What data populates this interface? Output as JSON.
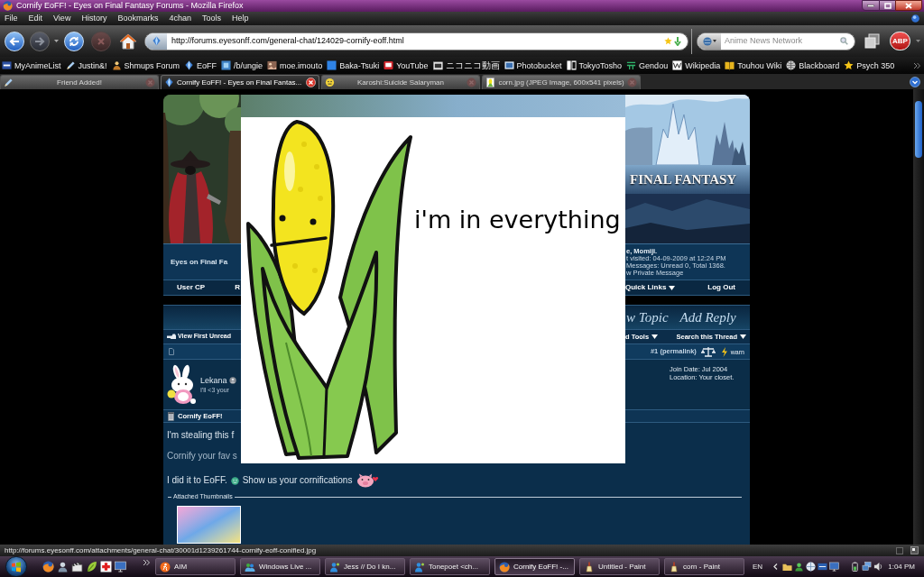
{
  "window": {
    "title": "Cornify EoFF! - Eyes on Final Fantasy Forums - Mozilla Firefox"
  },
  "menu": [
    "File",
    "Edit",
    "View",
    "History",
    "Bookmarks",
    "4chan",
    "Tools",
    "Help"
  ],
  "navigation": {
    "url": "http://forums.eyesonff.com/general-chat/124029-cornify-eoff.html",
    "search": {
      "placeholder": "Anime News Network"
    },
    "adblock": "ABP"
  },
  "bookmarks": [
    "MyAnimeList",
    "Justin&!",
    "Shmups Forum",
    "EoFF",
    "/b/ungie",
    "moe.imouto",
    "Baka-Tsuki",
    "YouTube",
    "ニコニコ動画",
    "Photobucket",
    "TokyoTosho",
    "Gendou",
    "Wikipedia",
    "Touhou Wiki",
    "Blackboard",
    "Psych 350"
  ],
  "tabs": [
    {
      "label": "Friend Added!",
      "selected": false
    },
    {
      "label": "Cornify EoFF! - Eyes on Final Fantas...",
      "selected": true
    },
    {
      "label": "Karoshi:Suicide Salaryman",
      "selected": false
    },
    {
      "label": "corn.jpg (JPEG Image, 600x541 pixels)",
      "selected": false
    }
  ],
  "forum": {
    "banner": {
      "logo": "FINAL FANTASY"
    },
    "header": {
      "site_title": "Eyes on Final Fa",
      "user_lines": [
        {
          "text": "e, Momiji.",
          "bold": true
        },
        {
          "text": "t visited: 04-09-2009 at 12:24 PM",
          "bold": false
        },
        {
          "text": "Messages: Unread 0, Total 1368.",
          "bold": false
        },
        {
          "text": "w Private Message",
          "bold": false
        }
      ]
    },
    "nav_links": {
      "left": [
        {
          "label": "User CP",
          "dropdown": false
        },
        {
          "label": "R",
          "dropdown": false
        }
      ],
      "right": [
        {
          "label": "Quick Links",
          "dropdown": true
        },
        {
          "label": "Log Out",
          "dropdown": false
        }
      ]
    },
    "post_buttons": [
      "w Topic",
      "Add Reply"
    ],
    "thread_bar": {
      "left": "View First Unread",
      "right": [
        {
          "label": "d Tools",
          "dropdown": true
        },
        {
          "label": "Search this Thread",
          "dropdown": true
        }
      ]
    },
    "post": {
      "permalink": "#1 (permalink)",
      "warn": "warn",
      "author": "Lekana",
      "user_title": "I'll <3 your",
      "details": [
        "Join Date: Jul 2004",
        "Location: Your closet."
      ],
      "title": "Cornify EoFF!",
      "body": [
        {
          "kind": "text",
          "text": "I'm stealing this f"
        },
        {
          "kind": "muted",
          "text": "Cornify your fav s"
        },
        {
          "kind": "smilies",
          "before": "I did it to EoFF.",
          "after": "Show us your cornifications"
        }
      ],
      "attachments": {
        "legend": "Attached Thumbnails"
      }
    }
  },
  "overlay": {
    "caption": "i'm in everything"
  },
  "status_bar": {
    "text": "http://forums.eyesonff.com/attachments/general-chat/30001d1239261744-cornify-eoff-conified.jpg"
  },
  "taskbar": {
    "buttons": [
      {
        "label": "AIM",
        "selected": false
      },
      {
        "label": "Windows Live ...",
        "selected": false
      },
      {
        "label": "Jess // Do I kn...",
        "selected": false
      },
      {
        "label": "Tonepoet <ch...",
        "selected": false
      },
      {
        "label": "Cornify EoFF! -...",
        "selected": true
      },
      {
        "label": "Untitled - Paint",
        "selected": false
      },
      {
        "label": "corn - Paint",
        "selected": false
      }
    ],
    "language": "EN",
    "clock": "1:04 PM"
  }
}
